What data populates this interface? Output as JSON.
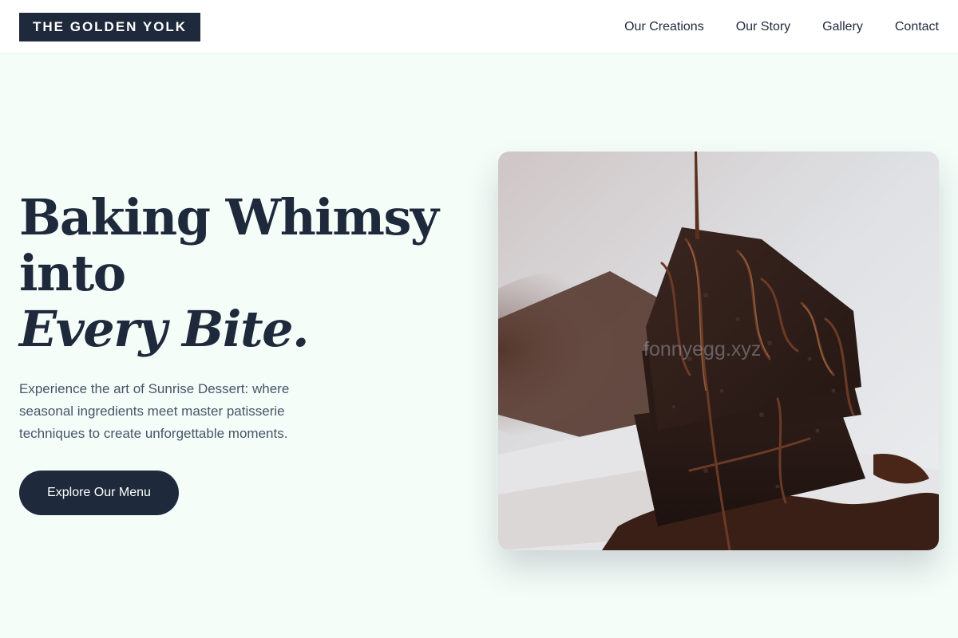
{
  "header": {
    "logo": "THE GOLDEN YOLK",
    "nav": [
      {
        "label": "Our Creations"
      },
      {
        "label": "Our Story"
      },
      {
        "label": "Gallery"
      },
      {
        "label": "Contact"
      }
    ]
  },
  "hero": {
    "title_line1": "Baking Whimsy",
    "title_line2": "into",
    "title_accent": "Every Bite.",
    "subtitle": "Experience the art of Sunrise Dessert: where seasonal ingredients meet master patisserie techniques to create unforgettable moments.",
    "cta_label": "Explore Our Menu",
    "image_watermark": "fonnyegg.xyz"
  },
  "colors": {
    "background": "#f4fdf8",
    "primary": "#1e293b",
    "text_muted": "#475569",
    "header_bg": "#ffffff"
  }
}
